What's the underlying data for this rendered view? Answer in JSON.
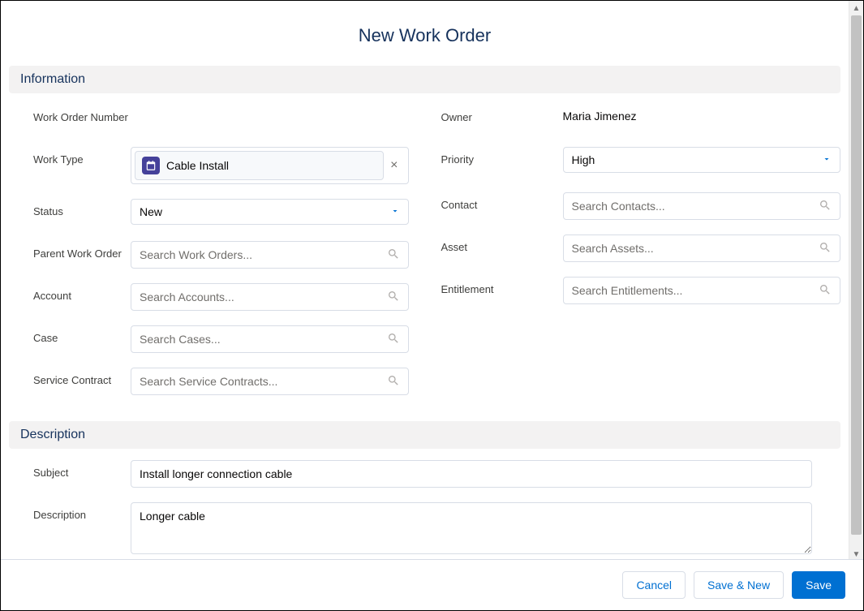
{
  "page": {
    "title": "New Work Order"
  },
  "sections": {
    "information": {
      "header": "Information"
    },
    "description": {
      "header": "Description"
    }
  },
  "fields": {
    "work_order_number": {
      "label": "Work Order Number"
    },
    "work_type": {
      "label": "Work Type",
      "chip_value": "Cable Install"
    },
    "status": {
      "label": "Status",
      "selected": "New"
    },
    "parent_work_order": {
      "label": "Parent Work Order",
      "placeholder": "Search Work Orders..."
    },
    "account": {
      "label": "Account",
      "placeholder": "Search Accounts..."
    },
    "case": {
      "label": "Case",
      "placeholder": "Search Cases..."
    },
    "service_contract": {
      "label": "Service Contract",
      "placeholder": "Search Service Contracts..."
    },
    "owner": {
      "label": "Owner",
      "value": "Maria Jimenez"
    },
    "priority": {
      "label": "Priority",
      "selected": "High"
    },
    "contact": {
      "label": "Contact",
      "placeholder": "Search Contacts..."
    },
    "asset": {
      "label": "Asset",
      "placeholder": "Search Assets..."
    },
    "entitlement": {
      "label": "Entitlement",
      "placeholder": "Search Entitlements..."
    },
    "subject": {
      "label": "Subject",
      "value": "Install longer connection cable"
    },
    "description": {
      "label": "Description",
      "value": "Longer cable"
    }
  },
  "buttons": {
    "cancel": "Cancel",
    "save_new": "Save & New",
    "save": "Save"
  }
}
